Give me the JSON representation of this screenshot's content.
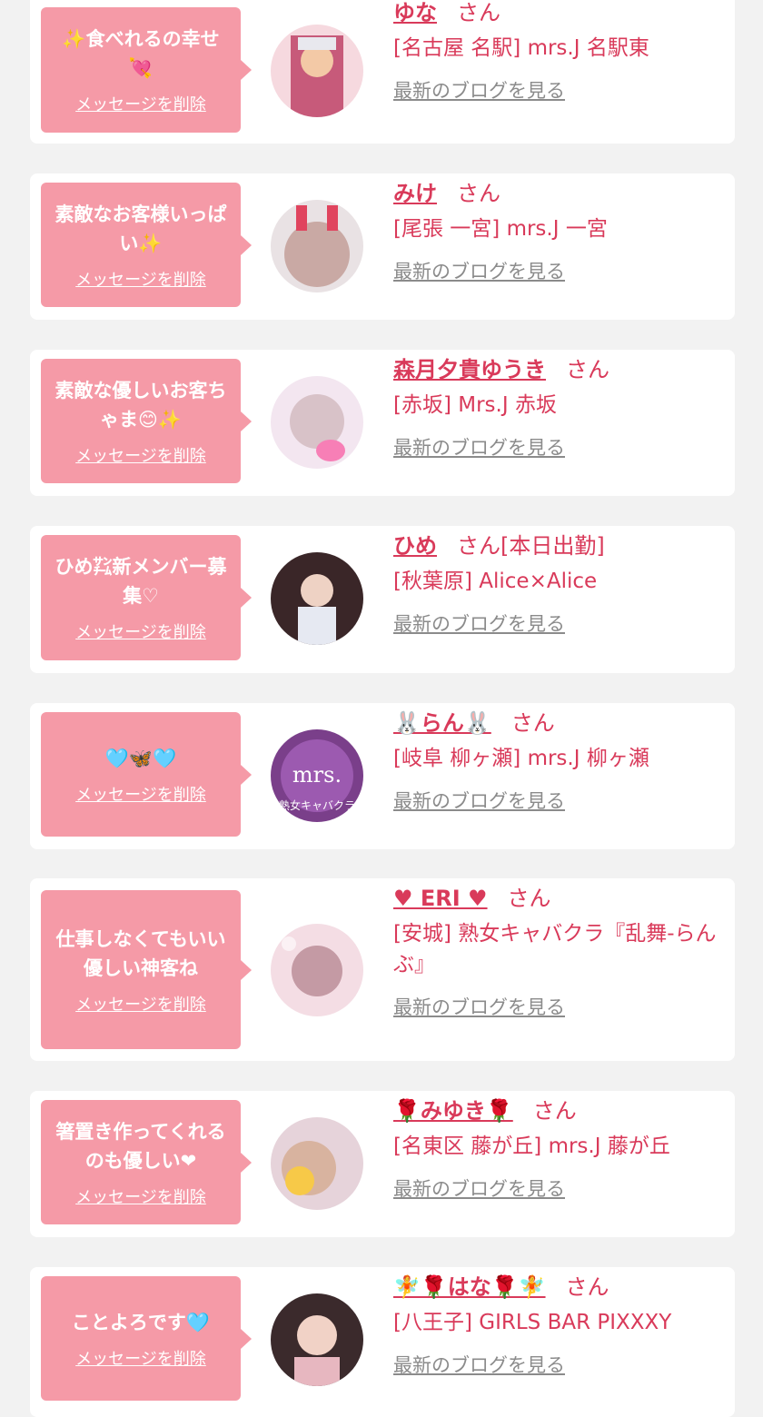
{
  "colors": {
    "background": "#f2f2f2",
    "card": "#ffffff",
    "bubble": "#f59aa7",
    "accent": "#d93a5a",
    "link_gray": "#8b8b8b"
  },
  "common": {
    "delete_label": "メッセージを削除",
    "blog_label": "最新のブログを見る",
    "san": "さん"
  },
  "items": [
    {
      "message": "✨食べれるの幸せ💘",
      "name": "ゆな",
      "suffix": "",
      "shop": "[名古屋 名駅] mrs.J 名駅東",
      "avatar": "photo"
    },
    {
      "message": "素敵なお客様いっぱい✨",
      "name": "みけ",
      "suffix": "",
      "shop": "[尾張 一宮] mrs.J 一宮",
      "avatar": "photo"
    },
    {
      "message": "素敵な優しいお客ちゃま😊✨",
      "name": "森月夕貴ゆうき",
      "suffix": "",
      "shop": "[赤坂] Mrs.J 赤坂",
      "avatar": "photo"
    },
    {
      "message": "ひめ㌠新メンバー募集♡",
      "name": "ひめ",
      "suffix": "[本日出勤]",
      "shop": "[秋葉原] Alice×Alice",
      "avatar": "photo"
    },
    {
      "message": "🩵🦋🩵",
      "name": "🐰らん🐰",
      "suffix": "",
      "shop": "[岐阜 柳ヶ瀬] mrs.J 柳ヶ瀬",
      "avatar": "logo",
      "logo_text": "mrs.",
      "logo_subtext": "熟女キャバクラ"
    },
    {
      "message": "仕事しなくてもいい優しい神客ね",
      "name": "♥ ERI ♥",
      "suffix": "",
      "shop": "[安城] 熟女キャバクラ『乱舞-らんぶ』",
      "avatar": "photo"
    },
    {
      "message": "箸置き作ってくれるのも優しい❤",
      "name": "🌹みゆき🌹",
      "suffix": "",
      "shop": "[名東区 藤が丘] mrs.J 藤が丘",
      "avatar": "photo"
    },
    {
      "message": "ことよろです🩵",
      "name": "🧚🌹はな🌹🧚",
      "suffix": "",
      "shop": "[八王子] GIRLS BAR PIXXXY",
      "avatar": "photo"
    }
  ]
}
